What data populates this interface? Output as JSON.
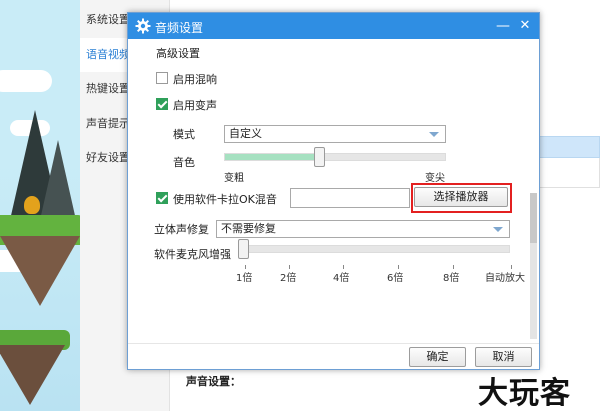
{
  "background": {
    "sidebar": [
      {
        "label": "系统设置"
      },
      {
        "label": "语音视频"
      },
      {
        "label": "热键设置"
      },
      {
        "label": "声音提示"
      },
      {
        "label": "好友设置"
      }
    ],
    "section_label": "声音设置：",
    "watermark": "大玩客"
  },
  "dialog": {
    "title": "音频设置",
    "minimize_icon": "minimize-icon",
    "close_icon": "close-icon",
    "section_title": "高级设置",
    "reverb": {
      "label": "启用混响",
      "checked": false
    },
    "voice_change": {
      "label": "启用变声",
      "checked": true
    },
    "mode": {
      "label": "模式",
      "value": "自定义"
    },
    "timbre": {
      "label": "音色",
      "min_label": "变粗",
      "max_label": "变尖",
      "level": 0.43
    },
    "karaoke": {
      "label": "使用软件卡拉OK混音",
      "checked": true,
      "value": "",
      "button": "选择播放器"
    },
    "stereo": {
      "label": "立体声修复",
      "value": "不需要修复"
    },
    "mic_boost": {
      "label": "软件麦克风增强",
      "level": 0,
      "ticks": [
        "1倍",
        "2倍",
        "4倍",
        "6倍",
        "8倍",
        "自动放大"
      ]
    },
    "ok_button": "确定",
    "cancel_button": "取消"
  },
  "colors": {
    "titlebar": "#2f8ee3",
    "checkbox_checked": "#2fa05a",
    "slider_fill": "#a6e1c1",
    "highlight": "#e32020"
  }
}
